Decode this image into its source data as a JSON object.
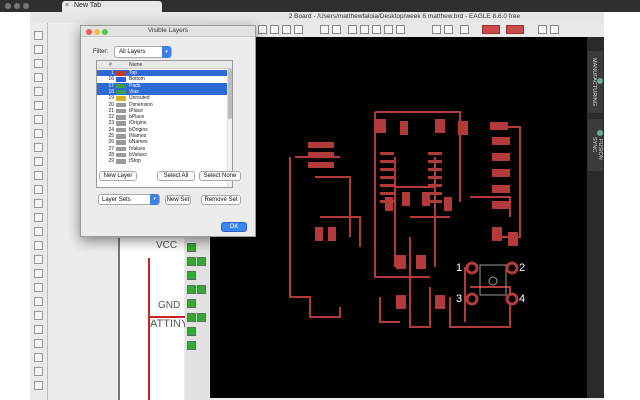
{
  "browser": {
    "tab_title": "New Tab",
    "close_glyph": "×"
  },
  "eagle": {
    "window_title": "2 Board - /Users/matthewfaloia/Desktop/week 6 matthew.brd - EAGLE 8.6.0 free"
  },
  "schematic": {
    "vcc_label": "VCC",
    "gnd_label": "GND",
    "attiny_label": "ATTINY"
  },
  "side_panel": {
    "manufacturing_label": "MANUFACTURING",
    "fusion_sync_label": "FUSION SYNC"
  },
  "dialog": {
    "title": "Visible Layers",
    "filter_label": "Filter:",
    "filter_value": "All Layers",
    "header_number": "#",
    "header_name": "Name",
    "layers": [
      {
        "number": "1",
        "name": "Top",
        "color": "#c0392b",
        "selected": true
      },
      {
        "number": "16",
        "name": "Bottom",
        "color": "#2e5fd6",
        "selected": false
      },
      {
        "number": "17",
        "name": "Pads",
        "color": "#3a9e4a",
        "selected": true
      },
      {
        "number": "18",
        "name": "Vias",
        "color": "#3a9e4a",
        "selected": true
      },
      {
        "number": "19",
        "name": "Unrouted",
        "color": "#d4b11c",
        "selected": false
      },
      {
        "number": "20",
        "name": "Dimension",
        "color": "#9a9a9a",
        "selected": false
      },
      {
        "number": "21",
        "name": "tPlace",
        "color": "#9a9a9a",
        "selected": false
      },
      {
        "number": "22",
        "name": "bPlace",
        "color": "#9a9a9a",
        "selected": false
      },
      {
        "number": "23",
        "name": "tOrigins",
        "color": "#9a9a9a",
        "selected": false
      },
      {
        "number": "24",
        "name": "bOrigins",
        "color": "#9a9a9a",
        "selected": false
      },
      {
        "number": "25",
        "name": "tNames",
        "color": "#9a9a9a",
        "selected": false
      },
      {
        "number": "26",
        "name": "bNames",
        "color": "#9a9a9a",
        "selected": false
      },
      {
        "number": "27",
        "name": "tValues",
        "color": "#9a9a9a",
        "selected": false
      },
      {
        "number": "28",
        "name": "bValues",
        "color": "#9a9a9a",
        "selected": false
      },
      {
        "number": "29",
        "name": "tStop",
        "color": "#9a9a9a",
        "selected": false
      }
    ],
    "new_layer_button": "New Layer",
    "select_all_button": "Select All",
    "select_none_button": "Select None",
    "layer_sets_value": "Layer Sets",
    "new_set_button": "New Set",
    "remove_set_button": "Remove Set",
    "ok_button": "OK"
  },
  "board": {
    "pad_labels": [
      "1",
      "2",
      "3",
      "4"
    ],
    "trace_color": "#b33a3a",
    "background_color": "#000000"
  }
}
